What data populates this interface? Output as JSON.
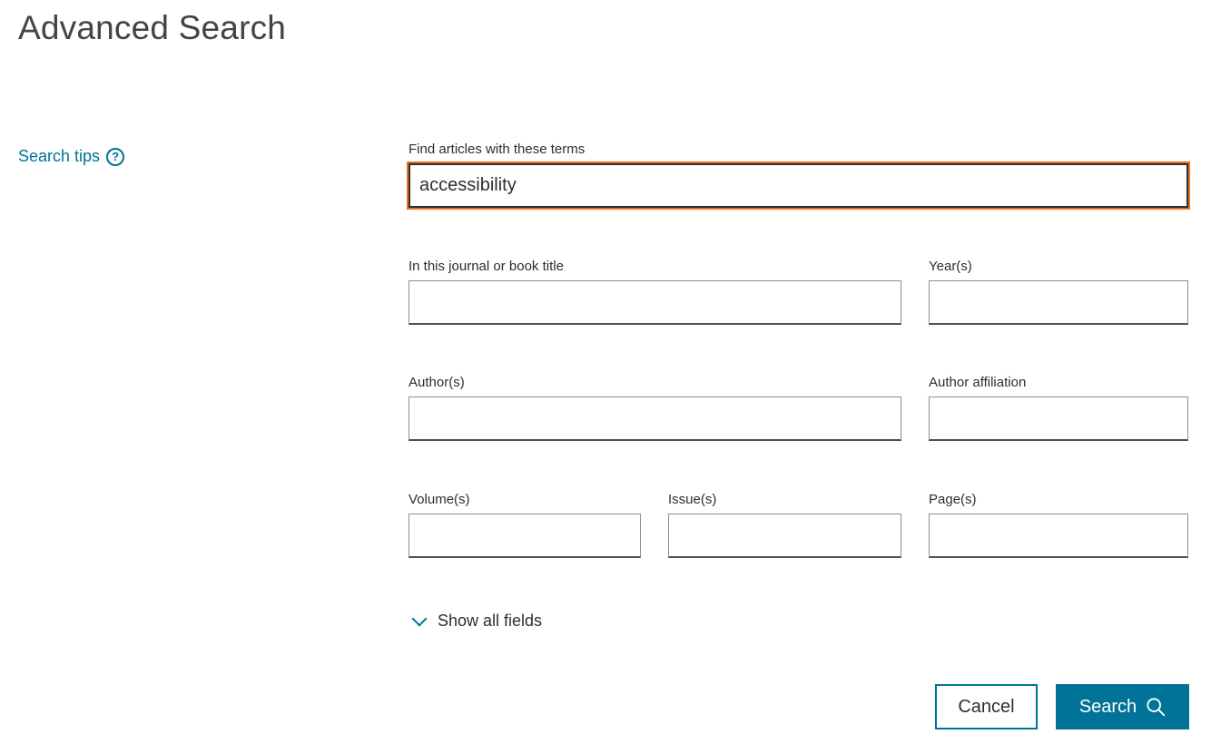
{
  "page": {
    "title": "Advanced Search"
  },
  "sidebar": {
    "search_tips_label": "Search tips",
    "help_glyph": "?"
  },
  "form": {
    "terms": {
      "label": "Find articles with these terms",
      "value": "accessibility"
    },
    "journal": {
      "label": "In this journal or book title",
      "value": ""
    },
    "years": {
      "label": "Year(s)",
      "value": ""
    },
    "authors": {
      "label": "Author(s)",
      "value": ""
    },
    "affiliation": {
      "label": "Author affiliation",
      "value": ""
    },
    "volume": {
      "label": "Volume(s)",
      "value": ""
    },
    "issue": {
      "label": "Issue(s)",
      "value": ""
    },
    "pages": {
      "label": "Page(s)",
      "value": ""
    },
    "show_all_label": "Show all fields"
  },
  "actions": {
    "cancel_label": "Cancel",
    "search_label": "Search"
  },
  "colors": {
    "accent": "#007398",
    "focus_ring": "#e9711c"
  },
  "icons": {
    "help": "question-circle-icon",
    "expand": "chevron-down-icon",
    "search": "magnifier-icon"
  }
}
